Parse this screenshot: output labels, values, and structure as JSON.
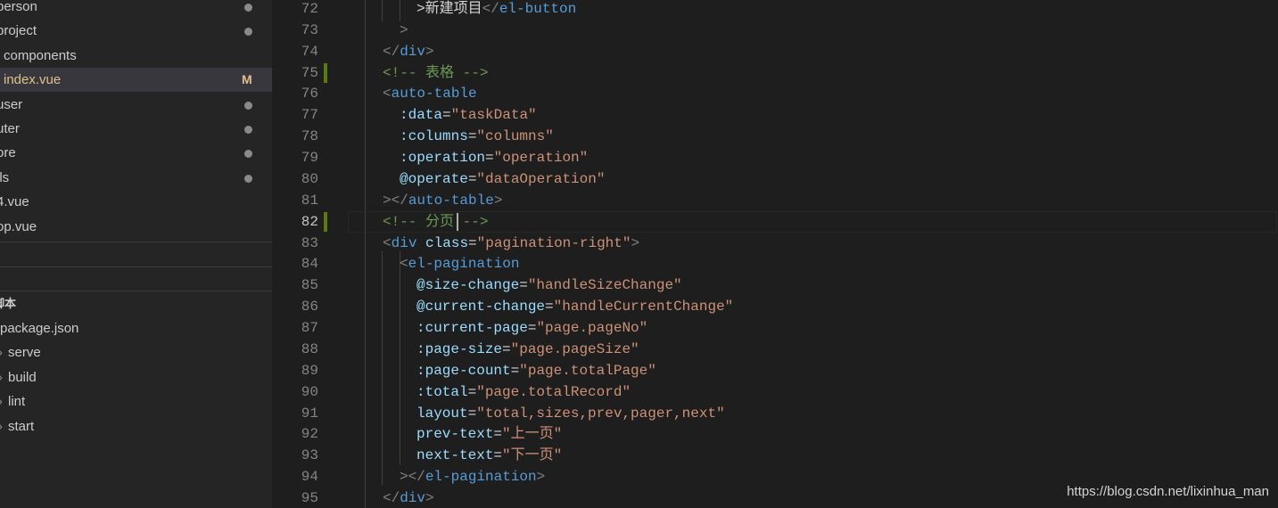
{
  "explorer": {
    "items": [
      {
        "label": "person",
        "status": "dot"
      },
      {
        "label": "project",
        "status": "dot"
      },
      {
        "label": "components",
        "status": ""
      },
      {
        "label": "index.vue",
        "status": "M",
        "active": true
      },
      {
        "label": "user",
        "status": "dot"
      },
      {
        "label": "uter",
        "status": "dot"
      },
      {
        "label": "ore",
        "status": "dot"
      },
      {
        "label": "ils",
        "status": "dot"
      },
      {
        "label": "4.vue",
        "status": ""
      },
      {
        "label": "op.vue",
        "status": ""
      }
    ],
    "modified_badge": "M"
  },
  "npm_scripts": {
    "title": "脚本",
    "package": "package.json",
    "scripts": [
      "serve",
      "build",
      "lint",
      "start"
    ]
  },
  "editor": {
    "current_line": 82,
    "modified_lines": [
      75,
      82
    ],
    "lines": [
      {
        "n": 72,
        "tokens": [
          {
            "t": ">新建项目",
            "c": "text"
          },
          {
            "t": "</",
            "c": "tag"
          },
          {
            "t": "el-button",
            "c": "name"
          }
        ]
      },
      {
        "n": 73,
        "tokens": [
          {
            "t": ">",
            "c": "tag"
          }
        ]
      },
      {
        "n": 74,
        "tokens": [
          {
            "t": "</",
            "c": "tag"
          },
          {
            "t": "div",
            "c": "name"
          },
          {
            "t": ">",
            "c": "tag"
          }
        ]
      },
      {
        "n": 75,
        "tokens": [
          {
            "t": "<!-- 表格 -->",
            "c": "com"
          }
        ]
      },
      {
        "n": 76,
        "tokens": [
          {
            "t": "<",
            "c": "tag"
          },
          {
            "t": "auto-table",
            "c": "name"
          }
        ]
      },
      {
        "n": 77,
        "tokens": [
          {
            "t": ":data",
            "c": "attr"
          },
          {
            "t": "=",
            "c": "eq"
          },
          {
            "t": "\"taskData\"",
            "c": "str"
          }
        ]
      },
      {
        "n": 78,
        "tokens": [
          {
            "t": ":columns",
            "c": "attr"
          },
          {
            "t": "=",
            "c": "eq"
          },
          {
            "t": "\"columns\"",
            "c": "str"
          }
        ]
      },
      {
        "n": 79,
        "tokens": [
          {
            "t": ":operation",
            "c": "attr"
          },
          {
            "t": "=",
            "c": "eq"
          },
          {
            "t": "\"operation\"",
            "c": "str"
          }
        ]
      },
      {
        "n": 80,
        "tokens": [
          {
            "t": "@operate",
            "c": "attr"
          },
          {
            "t": "=",
            "c": "eq"
          },
          {
            "t": "\"dataOperation\"",
            "c": "str"
          }
        ]
      },
      {
        "n": 81,
        "tokens": [
          {
            "t": "></",
            "c": "tag"
          },
          {
            "t": "auto-table",
            "c": "name"
          },
          {
            "t": ">",
            "c": "tag"
          }
        ]
      },
      {
        "n": 82,
        "tokens": [
          {
            "t": "<!-- 分页 -->",
            "c": "com"
          }
        ]
      },
      {
        "n": 83,
        "tokens": [
          {
            "t": "<",
            "c": "tag"
          },
          {
            "t": "div",
            "c": "name"
          },
          {
            "t": " ",
            "c": "text"
          },
          {
            "t": "class",
            "c": "attr"
          },
          {
            "t": "=",
            "c": "eq"
          },
          {
            "t": "\"pagination-right\"",
            "c": "str"
          },
          {
            "t": ">",
            "c": "tag"
          }
        ]
      },
      {
        "n": 84,
        "tokens": [
          {
            "t": "<",
            "c": "tag"
          },
          {
            "t": "el-pagination",
            "c": "name"
          }
        ]
      },
      {
        "n": 85,
        "tokens": [
          {
            "t": "@size-change",
            "c": "attr"
          },
          {
            "t": "=",
            "c": "eq"
          },
          {
            "t": "\"handleSizeChange\"",
            "c": "str"
          }
        ]
      },
      {
        "n": 86,
        "tokens": [
          {
            "t": "@current-change",
            "c": "attr"
          },
          {
            "t": "=",
            "c": "eq"
          },
          {
            "t": "\"handleCurrentChange\"",
            "c": "str"
          }
        ]
      },
      {
        "n": 87,
        "tokens": [
          {
            "t": ":current-page",
            "c": "attr"
          },
          {
            "t": "=",
            "c": "eq"
          },
          {
            "t": "\"page.pageNo\"",
            "c": "str"
          }
        ]
      },
      {
        "n": 88,
        "tokens": [
          {
            "t": ":page-size",
            "c": "attr"
          },
          {
            "t": "=",
            "c": "eq"
          },
          {
            "t": "\"page.pageSize\"",
            "c": "str"
          }
        ]
      },
      {
        "n": 89,
        "tokens": [
          {
            "t": ":page-count",
            "c": "attr"
          },
          {
            "t": "=",
            "c": "eq"
          },
          {
            "t": "\"page.totalPage\"",
            "c": "str"
          }
        ]
      },
      {
        "n": 90,
        "tokens": [
          {
            "t": ":total",
            "c": "attr"
          },
          {
            "t": "=",
            "c": "eq"
          },
          {
            "t": "\"page.totalRecord\"",
            "c": "str"
          }
        ]
      },
      {
        "n": 91,
        "tokens": [
          {
            "t": "layout",
            "c": "attr"
          },
          {
            "t": "=",
            "c": "eq"
          },
          {
            "t": "\"total,sizes,prev,pager,next\"",
            "c": "str"
          }
        ]
      },
      {
        "n": 92,
        "tokens": [
          {
            "t": "prev-text",
            "c": "attr"
          },
          {
            "t": "=",
            "c": "eq"
          },
          {
            "t": "\"上一页\"",
            "c": "str"
          }
        ]
      },
      {
        "n": 93,
        "tokens": [
          {
            "t": "next-text",
            "c": "attr"
          },
          {
            "t": "=",
            "c": "eq"
          },
          {
            "t": "\"下一页\"",
            "c": "str"
          }
        ]
      },
      {
        "n": 94,
        "tokens": [
          {
            "t": "></",
            "c": "tag"
          },
          {
            "t": "el-pagination",
            "c": "name"
          },
          {
            "t": ">",
            "c": "tag"
          }
        ]
      },
      {
        "n": 95,
        "tokens": [
          {
            "t": "</",
            "c": "tag"
          },
          {
            "t": "div",
            "c": "name"
          },
          {
            "t": ">",
            "c": "tag"
          }
        ]
      }
    ]
  },
  "watermark": "https://blog.csdn.net/lixinhua_man"
}
